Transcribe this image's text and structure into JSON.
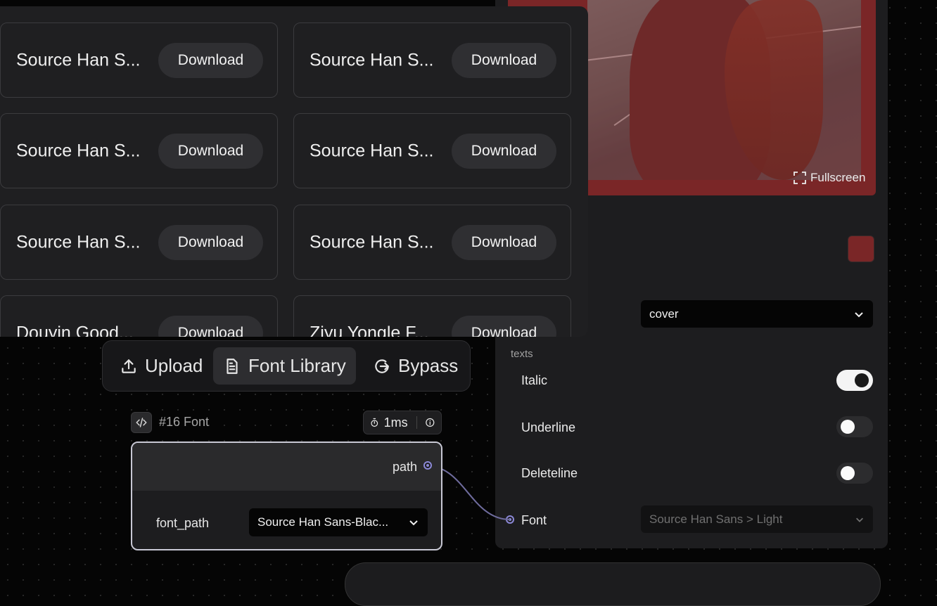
{
  "preview": {
    "fullscreen_label": "Fullscreen"
  },
  "colors": {
    "accent_swatch": "#7a2627",
    "port": "#8b88d6"
  },
  "properties": {
    "fit_select_value": "cover",
    "section_label": "texts",
    "italic_label": "Italic",
    "italic_on": true,
    "underline_label": "Underline",
    "underline_on": false,
    "deleteline_label": "Deleteline",
    "deleteline_on": false,
    "font_label": "Font",
    "font_select_value": "Source Han Sans > Light"
  },
  "font_library": {
    "download_label": "Download",
    "items": [
      {
        "name": "Source Han S..."
      },
      {
        "name": "Source Han S..."
      },
      {
        "name": "Source Han S..."
      },
      {
        "name": "Source Han S..."
      },
      {
        "name": "Source Han S..."
      },
      {
        "name": "Source Han S..."
      },
      {
        "name": "Douyin Good..."
      },
      {
        "name": "Ziyu Yongle F..."
      }
    ]
  },
  "toolbar": {
    "upload_label": "Upload",
    "font_library_label": "Font Library",
    "bypass_label": "Bypass"
  },
  "font_node": {
    "title": "#16 Font",
    "timing": "1ms",
    "output_label": "path",
    "input_label": "font_path",
    "font_path_value": "Source Han Sans-Blac..."
  }
}
